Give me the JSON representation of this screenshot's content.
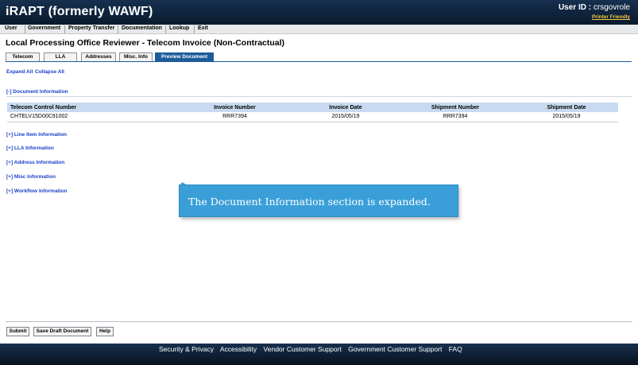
{
  "header": {
    "app_title": "iRAPT (formerly WAWF)",
    "user_id_label": "User ID :",
    "user_id_value": "crsgovrole",
    "printer_friendly": "Printer Friendly"
  },
  "menu": {
    "items": [
      "User",
      "Government",
      "Property Transfer",
      "Documentation",
      "Lookup",
      "Exit"
    ]
  },
  "page_title": "Local Processing Office Reviewer - Telecom Invoice (Non-Contractual)",
  "tabs": [
    "Telecom",
    "LLA",
    "Addresses",
    "Misc. Info",
    "Preview Document"
  ],
  "active_tab": "Preview Document",
  "expand_all": "Expand All",
  "collapse_all": "Collapse All",
  "document_info_toggle": "[-] Document Information",
  "table": {
    "headers": [
      "Telecom Control Number",
      "Invoice Number",
      "Invoice Date",
      "Shipment Number",
      "Shipment Date"
    ],
    "row": [
      "CHTELV15D00C91002",
      "RRR7394",
      "2015/05/19",
      "RRR7394",
      "2015/05/19"
    ]
  },
  "sections": [
    "[+] Line Item Information",
    "[+] LLA Information",
    "[+] Address Information",
    "[+] Misc Information",
    "[+] Workflow Information"
  ],
  "callout": "The Document Information section is expanded.",
  "buttons": {
    "submit": "Submit",
    "save_draft": "Save Draft Document",
    "help": "Help"
  },
  "footer": {
    "links": [
      "Security & Privacy",
      "Accessibility",
      "Vendor Customer Support",
      "Government Customer Support",
      "FAQ"
    ]
  },
  "colors": {
    "header_bg": "#0e1f33",
    "active_tab": "#1d5c9a",
    "table_header": "#c7daf0",
    "link": "#1a3fc8",
    "callout": "#3a9fd8"
  }
}
